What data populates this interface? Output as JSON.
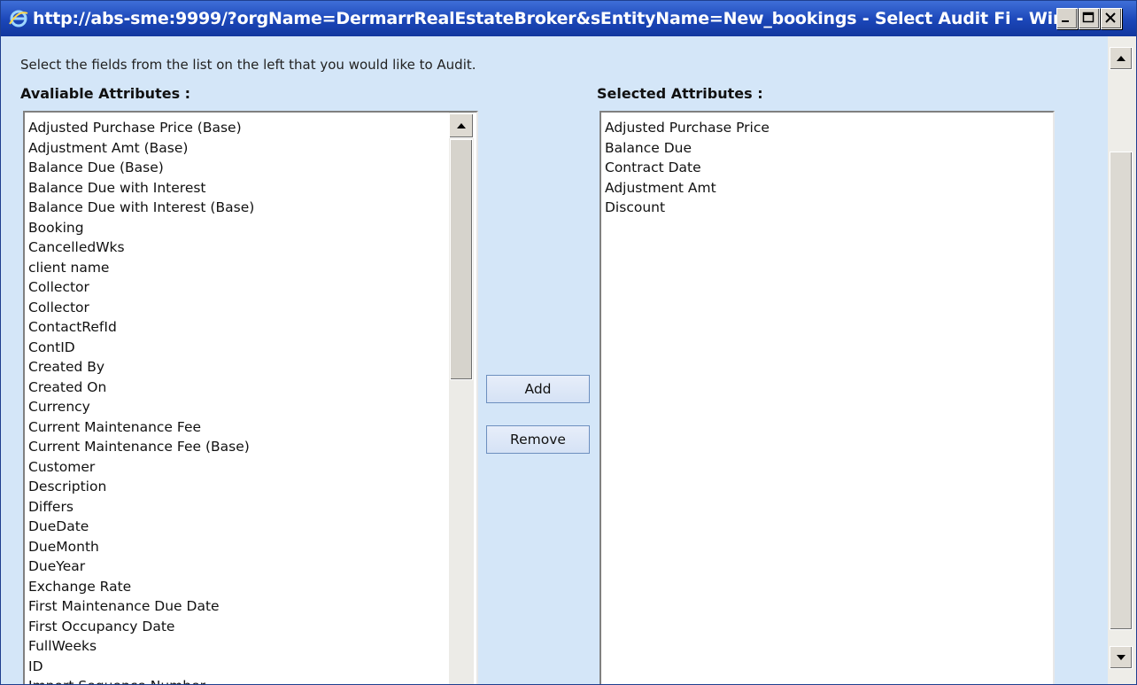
{
  "window": {
    "title": "http://abs-sme:9999/?orgName=DermarrRealEstateBroker&sEntityName=New_bookings - Select Audit Fi - Windo...",
    "icon": "ie-icon"
  },
  "dialog": {
    "instruction": "Select the fields from the list on the left that you would like to Audit.",
    "available_heading": "Avaliable Attributes :",
    "selected_heading": "Selected Attributes :",
    "add_label": "Add",
    "remove_label": "Remove",
    "available_items": [
      "Adjusted Purchase Price (Base)",
      "Adjustment Amt (Base)",
      "Balance Due (Base)",
      "Balance Due with Interest",
      "Balance Due with Interest (Base)",
      "Booking",
      "CancelledWks",
      "client name",
      "Collector",
      "Collector",
      "ContactRefId",
      "ContID",
      "Created By",
      "Created On",
      "Currency",
      "Current Maintenance Fee",
      "Current Maintenance Fee (Base)",
      "Customer",
      "Description",
      "Differs",
      "DueDate",
      "DueMonth",
      "DueYear",
      "Exchange Rate",
      "First Maintenance Due Date",
      "First Occupancy Date",
      "FullWeeks",
      "ID",
      "Import Sequence Number"
    ],
    "selected_items": [
      "Adjusted Purchase Price",
      "Balance Due",
      "Contract Date",
      "Adjustment Amt",
      "Discount"
    ]
  }
}
